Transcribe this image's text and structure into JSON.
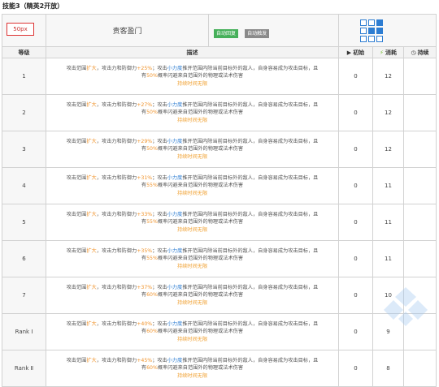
{
  "section": {
    "title": "技能3（精英2开放）"
  },
  "skill": {
    "icon_label": "50px",
    "name": "责客盈门",
    "tags": [
      "自动回复",
      "自动触发"
    ]
  },
  "columns": {
    "level": "等级",
    "description": "描述",
    "initial": "初始",
    "cost": "消耗",
    "duration": "持续"
  },
  "description_parts": {
    "range_prefix": "攻击范围",
    "expand": "扩大",
    "atk_def": "，攻击力和防御力",
    "mid": "；攻击",
    "small_force": "小力度",
    "push": "推开范围内除当前目标外的敌人，自身容易成为攻击目标，且",
    "have": "有",
    "dodge": "概率闪避来自范围外的物理或法术伤害",
    "duration_text": "持续时间无限"
  },
  "rows": [
    {
      "level": "1",
      "atk": "+25%",
      "dodge": "50%",
      "initial": "0",
      "cost": "12",
      "duration": ""
    },
    {
      "level": "2",
      "atk": "+27%",
      "dodge": "50%",
      "initial": "0",
      "cost": "12",
      "duration": ""
    },
    {
      "level": "3",
      "atk": "+29%",
      "dodge": "50%",
      "initial": "0",
      "cost": "12",
      "duration": ""
    },
    {
      "level": "4",
      "atk": "+31%",
      "dodge": "55%",
      "initial": "0",
      "cost": "11",
      "duration": ""
    },
    {
      "level": "5",
      "atk": "+33%",
      "dodge": "55%",
      "initial": "0",
      "cost": "11",
      "duration": ""
    },
    {
      "level": "6",
      "atk": "+35%",
      "dodge": "55%",
      "initial": "0",
      "cost": "11",
      "duration": ""
    },
    {
      "level": "7",
      "atk": "+37%",
      "dodge": "60%",
      "initial": "0",
      "cost": "10",
      "duration": ""
    },
    {
      "level": "Rank Ⅰ",
      "atk": "+40%",
      "dodge": "60%",
      "initial": "0",
      "cost": "9",
      "duration": ""
    },
    {
      "level": "Rank Ⅱ",
      "atk": "+45%",
      "dodge": "60%",
      "initial": "0",
      "cost": "8",
      "duration": ""
    }
  ],
  "range_pattern": [
    [
      0,
      0,
      1
    ],
    [
      0,
      1,
      1
    ],
    [
      0,
      0,
      0
    ]
  ],
  "colors": {
    "highlight_orange": "#f0932b",
    "highlight_blue": "#2d7dd2",
    "tag_green": "#46b05a",
    "duration": "#f0a030"
  }
}
